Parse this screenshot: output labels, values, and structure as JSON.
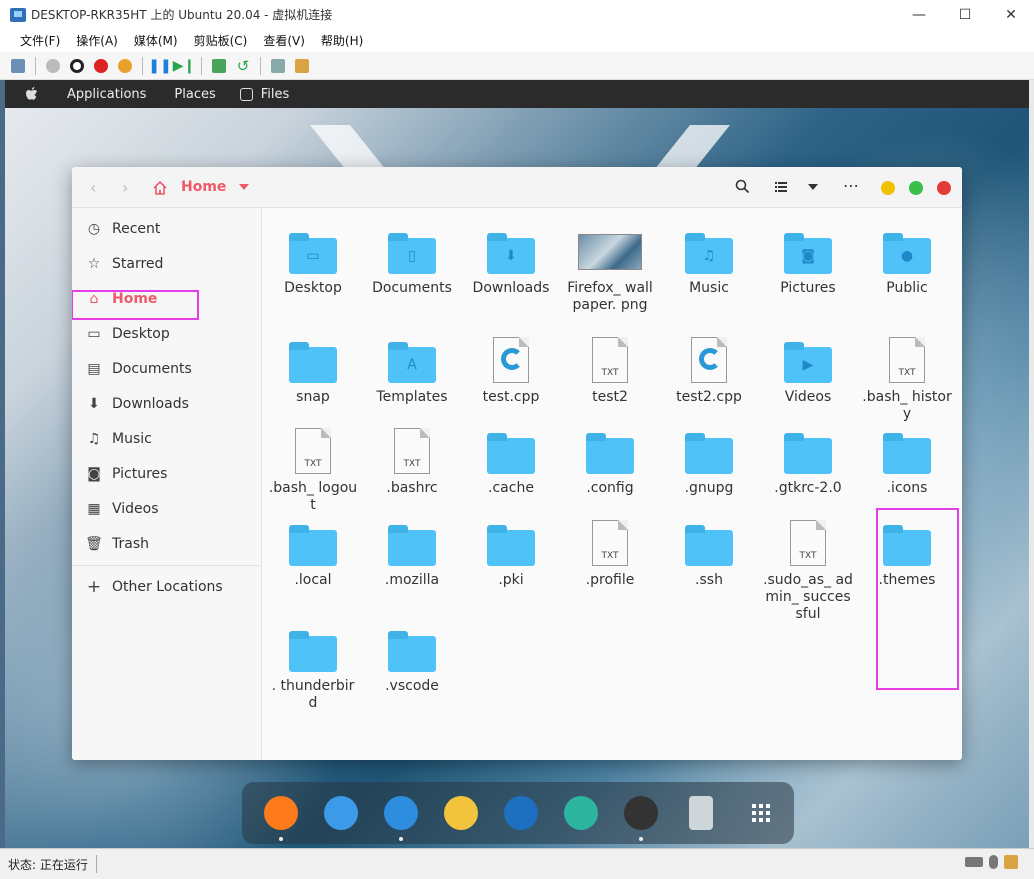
{
  "window": {
    "title": "DESKTOP-RKR35HT 上的 Ubuntu 20.04 - 虚拟机连接",
    "min_symbol": "—",
    "max_symbol": "☐",
    "close_symbol": "✕"
  },
  "menu": [
    "文件(F)",
    "操作(A)",
    "媒体(M)",
    "剪贴板(C)",
    "查看(V)",
    "帮助(H)"
  ],
  "ubuntu_topbar": {
    "applications": "Applications",
    "places": "Places",
    "files": "Files"
  },
  "nautilus": {
    "back": "‹",
    "forward": "›",
    "path": "Home",
    "search_icon": "search-icon",
    "view_icon": "list-view-icon",
    "more": "⋯",
    "window_dots": [
      "#f2c200",
      "#3bbf4a",
      "#e23b3b"
    ]
  },
  "sidebar": [
    {
      "label": "Recent",
      "icon": "clock-icon",
      "glyph": "◷"
    },
    {
      "label": "Starred",
      "icon": "star-icon",
      "glyph": "☆"
    },
    {
      "label": "Home",
      "icon": "home-icon",
      "glyph": "⌂",
      "active": true
    },
    {
      "label": "Desktop",
      "icon": "desktop-icon",
      "glyph": "▭"
    },
    {
      "label": "Documents",
      "icon": "documents-icon",
      "glyph": "▤"
    },
    {
      "label": "Downloads",
      "icon": "download-icon",
      "glyph": "⬇"
    },
    {
      "label": "Music",
      "icon": "music-icon",
      "glyph": "♫"
    },
    {
      "label": "Pictures",
      "icon": "camera-icon",
      "glyph": "◙"
    },
    {
      "label": "Videos",
      "icon": "film-icon",
      "glyph": "▦"
    },
    {
      "label": "Trash",
      "icon": "trash-icon",
      "glyph": "🗑"
    },
    {
      "label": "Other Locations",
      "icon": "plus-icon",
      "glyph": "+"
    }
  ],
  "files": [
    {
      "name": "Desktop",
      "type": "folder",
      "emblem": "▭"
    },
    {
      "name": "Documents",
      "type": "folder",
      "emblem": "▯"
    },
    {
      "name": "Downloads",
      "type": "folder",
      "emblem": "⬇"
    },
    {
      "name": "Firefox_ wallpaper. png",
      "type": "image"
    },
    {
      "name": "Music",
      "type": "folder",
      "emblem": "♫"
    },
    {
      "name": "Pictures",
      "type": "folder",
      "emblem": "◙"
    },
    {
      "name": "Public",
      "type": "folder",
      "emblem": "●"
    },
    {
      "name": "snap",
      "type": "folder"
    },
    {
      "name": "Templates",
      "type": "folder",
      "emblem": "A"
    },
    {
      "name": "test.cpp",
      "type": "cpp"
    },
    {
      "name": "test2",
      "type": "txt"
    },
    {
      "name": "test2.cpp",
      "type": "cpp"
    },
    {
      "name": "Videos",
      "type": "folder",
      "emblem": "▶"
    },
    {
      "name": ".bash_ history",
      "type": "txt"
    },
    {
      "name": ".bash_ logout",
      "type": "txt"
    },
    {
      "name": ".bashrc",
      "type": "txt"
    },
    {
      "name": ".cache",
      "type": "folder"
    },
    {
      "name": ".config",
      "type": "folder"
    },
    {
      "name": ".gnupg",
      "type": "folder"
    },
    {
      "name": ".gtkrc-2.0",
      "type": "folder"
    },
    {
      "name": ".icons",
      "type": "folder"
    },
    {
      "name": ".local",
      "type": "folder"
    },
    {
      "name": ".mozilla",
      "type": "folder"
    },
    {
      "name": ".pki",
      "type": "folder"
    },
    {
      "name": ".profile",
      "type": "txt"
    },
    {
      "name": ".ssh",
      "type": "folder"
    },
    {
      "name": ".sudo_as_ admin_ successful",
      "type": "txt"
    },
    {
      "name": ".themes",
      "type": "folder"
    },
    {
      "name": ". thunderbir d",
      "type": "folder"
    },
    {
      "name": ".vscode",
      "type": "folder"
    }
  ],
  "txt_label": "TXT",
  "dock": [
    {
      "name": "firefox",
      "color": "#ff7a1a",
      "running": true
    },
    {
      "name": "mail",
      "color": "#3d9ae8",
      "running": false
    },
    {
      "name": "finder",
      "color": "#2f8de0",
      "running": true
    },
    {
      "name": "music-player",
      "color": "#f2c33c",
      "running": false
    },
    {
      "name": "document-viewer",
      "color": "#1e6fbf",
      "running": false
    },
    {
      "name": "help",
      "color": "#2db5a0",
      "running": false
    },
    {
      "name": "terminal",
      "color": "#333333",
      "running": true
    },
    {
      "name": "trash",
      "color": "#cfd6da",
      "running": false
    },
    {
      "name": "app-grid",
      "color": "#ffffff",
      "running": false
    }
  ],
  "status": {
    "text": "状态: 正在运行"
  }
}
